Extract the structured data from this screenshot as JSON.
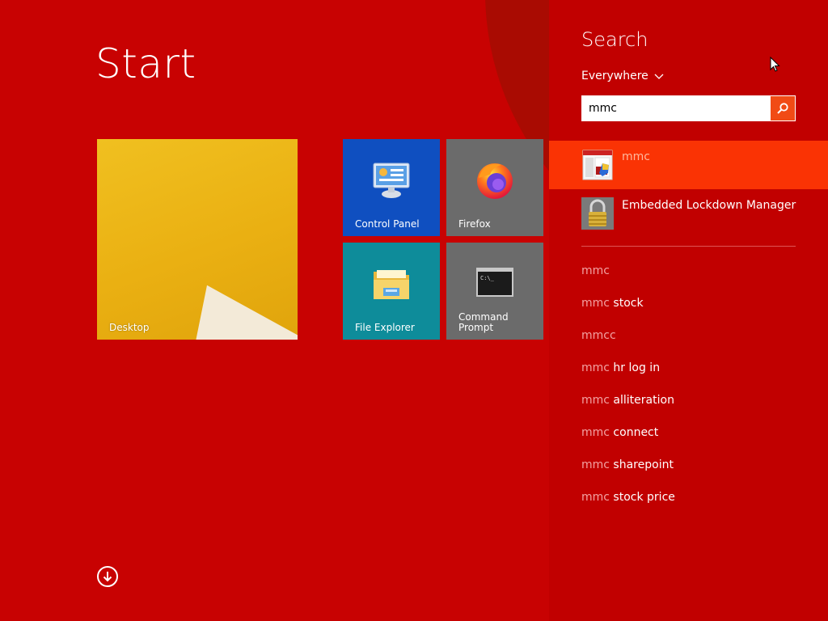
{
  "start": {
    "title": "Start",
    "tiles": {
      "desktop": "Desktop",
      "control_panel": "Control Panel",
      "firefox": "Firefox",
      "file_explorer": "File Explorer",
      "command_prompt_line1": "Command",
      "command_prompt_line2": "Prompt"
    }
  },
  "search": {
    "title": "Search",
    "scope": "Everywhere",
    "query": "mmc",
    "results": [
      {
        "label": "mmc",
        "icon": "mmc-app-icon",
        "selected": true
      },
      {
        "label": "Embedded Lockdown Manager",
        "icon": "padlock-app-icon",
        "selected": false
      }
    ],
    "suggestions": [
      {
        "prefix": "mmc",
        "suffix": ""
      },
      {
        "prefix": "mmc",
        "suffix": " stock"
      },
      {
        "prefix": "mmcc",
        "suffix": ""
      },
      {
        "prefix": "mmc",
        "suffix": " hr log in"
      },
      {
        "prefix": "mmc",
        "suffix": " alliteration"
      },
      {
        "prefix": "mmc",
        "suffix": " connect"
      },
      {
        "prefix": "mmc",
        "suffix": " sharepoint"
      },
      {
        "prefix": "mmc",
        "suffix": " stock price"
      }
    ]
  },
  "colors": {
    "start_bg": "#c80202",
    "pane_bg": "#c10000",
    "selected_result": "#fa3304",
    "search_button": "#f14b15"
  }
}
